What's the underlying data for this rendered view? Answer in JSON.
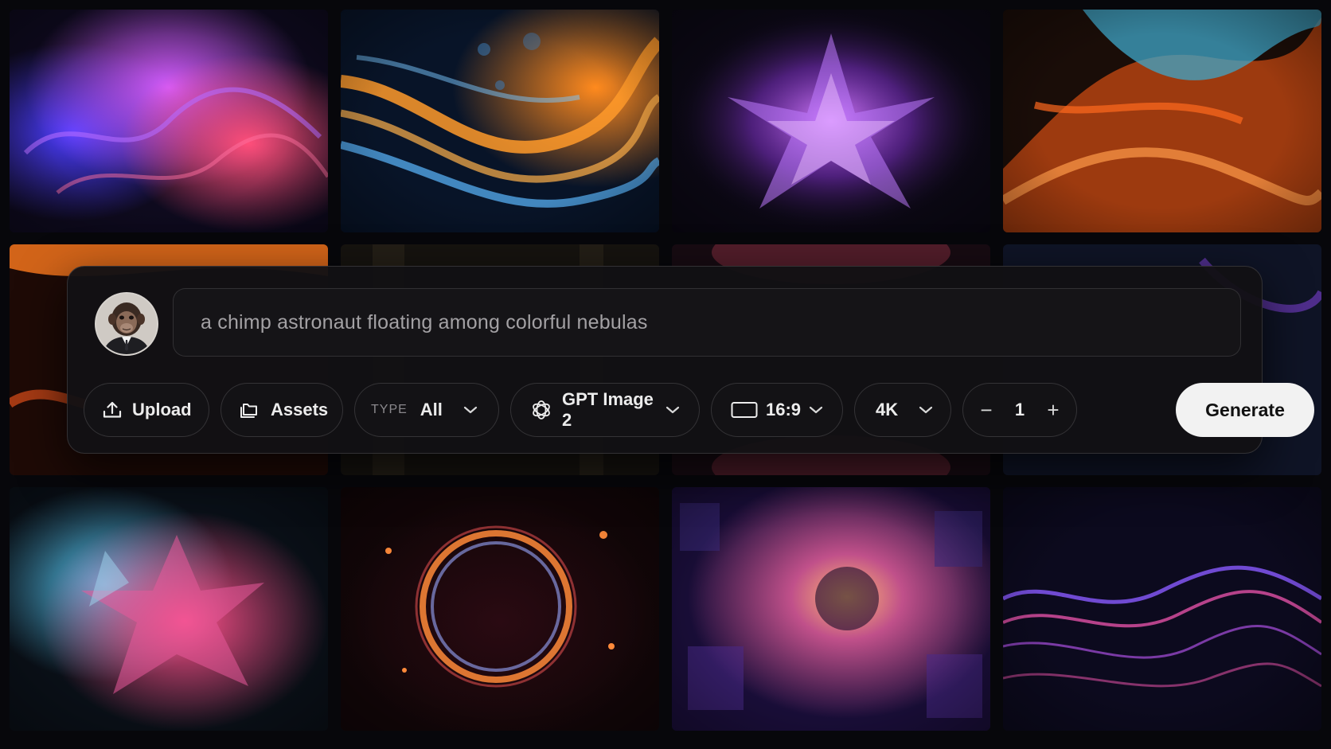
{
  "prompt": {
    "value": "a chimp astronaut floating among colorful nebulas"
  },
  "toolbar": {
    "upload_label": "Upload",
    "assets_label": "Assets",
    "type_tag": "TYPE",
    "type_value": "All",
    "model_value": "GPT Image 2",
    "aspect_value": "16:9",
    "resolution_value": "4K",
    "count_value": "1",
    "decrement_symbol": "−",
    "increment_symbol": "+",
    "generate_label": "Generate"
  },
  "icons": {
    "upload": "upload-icon",
    "assets": "folders-icon",
    "model": "openai-icon",
    "aspect": "aspect-ratio-icon",
    "dropdown": "chevron-down-icon"
  },
  "colors": {
    "panel_bg": "#121114",
    "generate_bg": "#f2f2f2",
    "text": "#ececec",
    "muted": "#8a888c"
  }
}
